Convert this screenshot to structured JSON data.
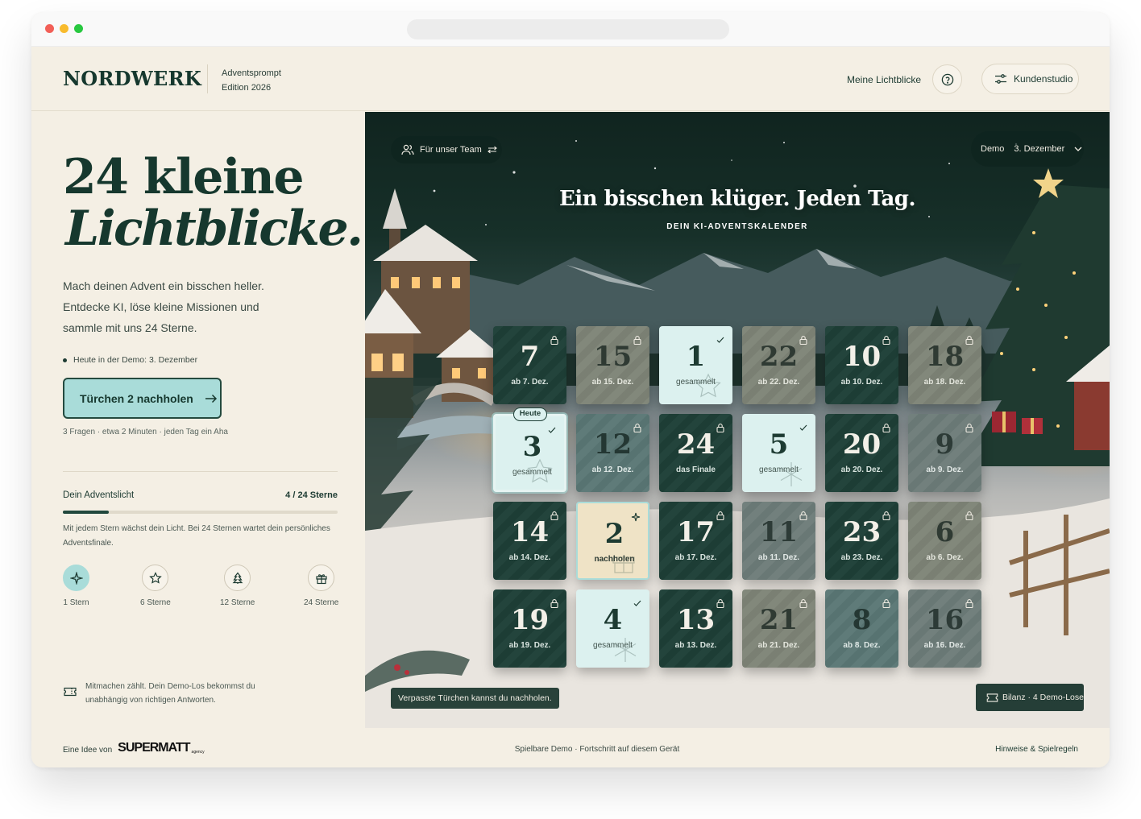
{
  "header": {
    "logo": "NORDWERK",
    "logo_sub_1": "Adventsprompt",
    "logo_sub_2": "Edition 2026",
    "nav_link": "Meine Lichtblicke",
    "help_icon": "help-circle-icon",
    "studio_label": "Kundenstudio",
    "studio_icon": "sliders-icon"
  },
  "hero": {
    "line1": "24 kleine",
    "line2": "Lichtblicke.",
    "intro": "Mach deinen Advent ein bisschen heller. Entdecke KI, löse kleine Missionen und sammle mit uns 24 Sterne.",
    "today_note": "Heute in der Demo: 3. Dezember",
    "cta_label": "Türchen 2 nachholen",
    "cta_icon": "arrow-right-icon",
    "meta": "3 Fragen · etwa 2 Minuten · jeden Tag ein Aha"
  },
  "progress": {
    "label": "Dein Adventslicht",
    "value_text": "4 / 24 Sterne",
    "fraction": 0.167,
    "note": "Mit jedem Stern wächst dein Licht. Bei 24 Sternen wartet dein persönliches Adventsfinale.",
    "milestones": [
      {
        "label": "1 Stern",
        "icon": "sparkle-icon",
        "active": true
      },
      {
        "label": "6 Sterne",
        "icon": "star-icon",
        "active": false
      },
      {
        "label": "12 Sterne",
        "icon": "tree-icon",
        "active": false
      },
      {
        "label": "24 Sterne",
        "icon": "gift-icon",
        "active": false
      }
    ]
  },
  "note_box": {
    "icon": "ticket-icon",
    "text": "Mitmachen zählt. Dein Demo-Los bekommst du unabhängig von richtigen Antworten."
  },
  "stage": {
    "team_pill": "Für unser Team",
    "demo_label": "Demo",
    "demo_date": "3. Dezember",
    "title": "Ein bisschen klüger. Jeden Tag.",
    "subtitle": "DEIN KI-ADVENTSKALENDER",
    "bottom_note": "Verpasste Türchen kannst du nachholen.",
    "bilanz": "Bilanz · 4 Demo-Lose",
    "today_badge": "Heute",
    "doors": [
      {
        "num": "7",
        "label": "ab 7. Dez.",
        "style": "dark",
        "state": "locked"
      },
      {
        "num": "15",
        "label": "ab 15. Dez.",
        "style": "taupe",
        "state": "locked"
      },
      {
        "num": "1",
        "label": "gesammelt",
        "style": "light",
        "state": "collected"
      },
      {
        "num": "22",
        "label": "ab 22. Dez.",
        "style": "taupe",
        "state": "locked"
      },
      {
        "num": "10",
        "label": "ab 10. Dez.",
        "style": "dark",
        "state": "locked"
      },
      {
        "num": "18",
        "label": "ab 18. Dez.",
        "style": "taupe",
        "state": "locked"
      },
      {
        "num": "3",
        "label": "gesammelt",
        "style": "light",
        "state": "today"
      },
      {
        "num": "12",
        "label": "ab 12. Dez.",
        "style": "teal",
        "state": "locked"
      },
      {
        "num": "24",
        "label": "das Finale",
        "style": "dark",
        "state": "locked"
      },
      {
        "num": "5",
        "label": "gesammelt",
        "style": "light",
        "state": "collected"
      },
      {
        "num": "20",
        "label": "ab 20. Dez.",
        "style": "dark",
        "state": "locked"
      },
      {
        "num": "9",
        "label": "ab 9. Dez.",
        "style": "gray",
        "state": "locked"
      },
      {
        "num": "14",
        "label": "ab 14. Dez.",
        "style": "dark",
        "state": "locked"
      },
      {
        "num": "2",
        "label": "nachholen",
        "style": "cream",
        "state": "catchup"
      },
      {
        "num": "17",
        "label": "ab 17. Dez.",
        "style": "dark",
        "state": "locked"
      },
      {
        "num": "11",
        "label": "ab 11. Dez.",
        "style": "gray",
        "state": "locked"
      },
      {
        "num": "23",
        "label": "ab 23. Dez.",
        "style": "dark",
        "state": "locked"
      },
      {
        "num": "6",
        "label": "ab 6. Dez.",
        "style": "taupe",
        "state": "locked"
      },
      {
        "num": "19",
        "label": "ab 19. Dez.",
        "style": "dark",
        "state": "locked"
      },
      {
        "num": "4",
        "label": "gesammelt",
        "style": "light",
        "state": "collected"
      },
      {
        "num": "13",
        "label": "ab 13. Dez.",
        "style": "dark",
        "state": "locked"
      },
      {
        "num": "21",
        "label": "ab 21. Dez.",
        "style": "taupe",
        "state": "locked"
      },
      {
        "num": "8",
        "label": "ab 8. Dez.",
        "style": "teal",
        "state": "locked"
      },
      {
        "num": "16",
        "label": "ab 16. Dez.",
        "style": "gray",
        "state": "locked"
      }
    ]
  },
  "footer": {
    "idea_prefix": "Eine Idee von",
    "brand": "SUPERMATT",
    "brand_sub": "agency",
    "center": "Spielbare Demo · Fortschritt auf diesem Gerät",
    "right": "Hinweise & Spielregeln"
  },
  "colors": {
    "accent_dark": "#1e3f37",
    "accent_mint": "#a9dcd9",
    "background": "#f4efe4"
  }
}
